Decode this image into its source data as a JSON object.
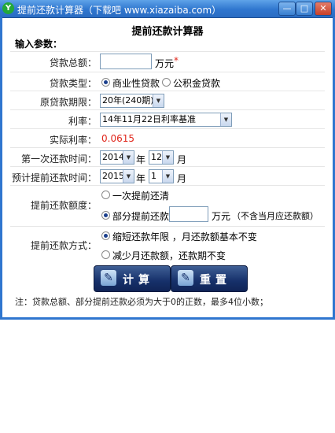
{
  "window": {
    "title": "提前还款计算器（下载吧 www.xiazaiba.com）",
    "icon": "app-logo-icon"
  },
  "heading": "提前还款计算器",
  "subheading": "输入参数：",
  "loan_amount": {
    "label": "贷款总额：",
    "value": "",
    "unit": "万元",
    "required_mark": "*"
  },
  "loan_type": {
    "label": "贷款类型：",
    "options": [
      "商业性贷款",
      "公积金贷款"
    ],
    "selected": "商业性贷款"
  },
  "term": {
    "label": "原贷款期限：",
    "value": "20年(240期)"
  },
  "rate": {
    "label": "利率：",
    "value": "14年11月22日利率基准"
  },
  "actual_rate": {
    "label": "实际利率：",
    "value": "0.0615",
    "color": "#e0261b"
  },
  "first_payment": {
    "label": "第一次还款时间：",
    "year": "2014",
    "year_unit": "年",
    "month": "12",
    "month_unit": "月"
  },
  "prepay_time": {
    "label": "预计提前还款时间：",
    "year": "2015",
    "year_unit": "年",
    "month": "1",
    "month_unit": "月"
  },
  "prepay_amount": {
    "label": "提前还款额度：",
    "option_full": "一次提前还清",
    "option_partial": "部分提前还款",
    "partial_value": "",
    "unit": "万元",
    "hint": "（不含当月应还款额）",
    "selected": "部分提前还款"
  },
  "prepay_method": {
    "label": "提前还款方式：",
    "option_shorten": "缩短还款年限 ，月还款额基本不变",
    "option_reduce": "减少月还款额，还款期不变",
    "selected": "缩短还款年限 ，月还款额基本不变"
  },
  "buttons": {
    "calculate": "计算",
    "reset": "重置"
  },
  "note": "注：贷款总额、部分提前还款必须为大于0的正数，最多4位小数；"
}
